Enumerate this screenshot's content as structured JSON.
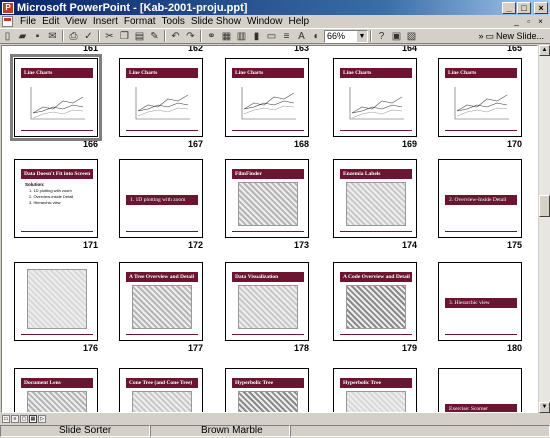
{
  "window": {
    "title": "Microsoft PowerPoint - [Kab-2001-proju.ppt]",
    "minimize": "_",
    "maximize": "□",
    "close": "×"
  },
  "menu": {
    "items": [
      {
        "label": "File"
      },
      {
        "label": "Edit"
      },
      {
        "label": "View"
      },
      {
        "label": "Insert"
      },
      {
        "label": "Format"
      },
      {
        "label": "Tools"
      },
      {
        "label": "Slide Show"
      },
      {
        "label": "Window"
      },
      {
        "label": "Help"
      }
    ]
  },
  "toolbar": {
    "zoom": "66%",
    "new_slide": "New Slide..."
  },
  "partial_numbers": [
    "161",
    "162",
    "163",
    "164",
    "165"
  ],
  "slides": [
    {
      "number": "166",
      "title": "Line Charts",
      "kind": "chart",
      "selected": true
    },
    {
      "number": "167",
      "title": "Line Charts",
      "kind": "chart"
    },
    {
      "number": "168",
      "title": "Line Charts",
      "kind": "chart"
    },
    {
      "number": "169",
      "title": "Line Charts",
      "kind": "chart"
    },
    {
      "number": "170",
      "title": "Line Charts",
      "kind": "chart"
    },
    {
      "number": "171",
      "title": "Data Doesn't Fit into Screen",
      "kind": "bullets",
      "bullets": [
        "Solution:",
        "1. 1D plotting with zoom",
        "2. Overview-inside Detail",
        "3. Hierarchic view"
      ]
    },
    {
      "number": "172",
      "title": "1.   1D plotting with zoom",
      "kind": "section"
    },
    {
      "number": "173",
      "title": "FilmFinder",
      "kind": "pic"
    },
    {
      "number": "174",
      "title": "Enzemia Labels",
      "kind": "pic"
    },
    {
      "number": "175",
      "title": "2.   Overview-Inside Detail",
      "kind": "section"
    },
    {
      "number": "176",
      "title": "",
      "kind": "pic"
    },
    {
      "number": "177",
      "title": "A Tree Overview and Detail",
      "kind": "pic"
    },
    {
      "number": "178",
      "title": "Data Visualization",
      "kind": "pic"
    },
    {
      "number": "179",
      "title": "A Code Overview and Detail",
      "kind": "pic"
    },
    {
      "number": "180",
      "title": "3.   Hierarchic view",
      "kind": "section"
    },
    {
      "number": "",
      "title": "Document Lens",
      "kind": "pic"
    },
    {
      "number": "",
      "title": "Cone Tree (and Cone Tree)",
      "kind": "pic"
    },
    {
      "number": "",
      "title": "Hyperbolic Tree",
      "kind": "pic"
    },
    {
      "number": "",
      "title": "Hyperbolic Tree",
      "kind": "pic"
    },
    {
      "number": "",
      "title": "Exercise: Scorner",
      "kind": "section"
    }
  ],
  "status": {
    "view": "Slide Sorter",
    "design": "Brown Marble"
  }
}
